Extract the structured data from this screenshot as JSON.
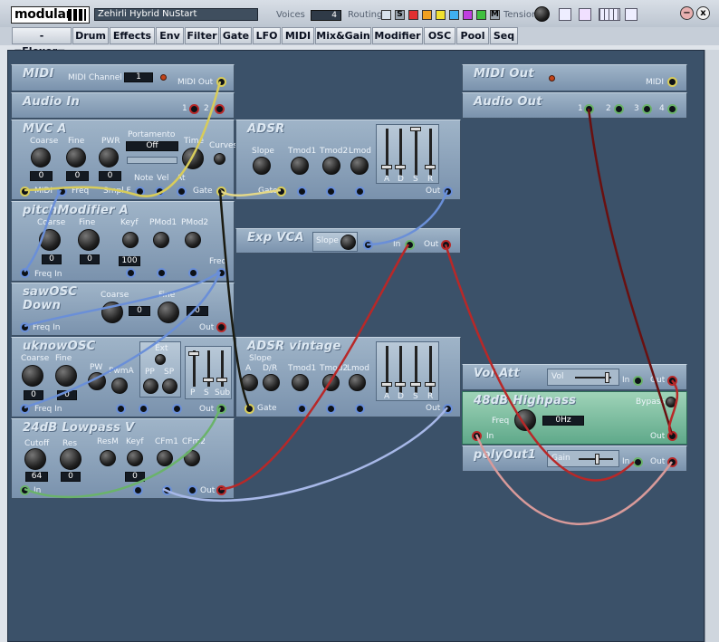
{
  "header": {
    "logo": "modular",
    "patch_name": "Zehirli  Hybrid NuStart",
    "voices_label": "Voices",
    "voices_value": "4",
    "routing_label": "Routing",
    "solo_label": "S",
    "mute_label": "M",
    "tension_label": "Tension",
    "minimize_label": "−",
    "close_label": "x"
  },
  "tabs": [
    "-=Flexor=-",
    "Drum",
    "Effects",
    "Env",
    "Filter",
    "Gate",
    "LFO",
    "MIDI",
    "Mix&Gain",
    "Modifier",
    "OSC",
    "Pool",
    "Seq"
  ],
  "colors": {
    "canvas": "#3b5169",
    "cable_yellow": "#d8cc5a",
    "cable_blue": "#6a8fd8",
    "cable_red": "#b82828",
    "cable_dark": "#6a1010",
    "cable_green": "#6ab36a",
    "cable_black": "#1a1a10",
    "cable_pink": "#d89a9a"
  },
  "modules": {
    "midi": {
      "title": "MIDI",
      "channel_label": "MIDI Channel",
      "channel_value": "1",
      "out_label": "MIDI Out"
    },
    "audio_in": {
      "title": "Audio In",
      "j1": "1",
      "j2": "2"
    },
    "mvca": {
      "title": "MVC A",
      "coarse": "Coarse",
      "fine": "Fine",
      "pwr": "PWR",
      "portamento": "Portamento",
      "porta_value": "Off",
      "time": "Time",
      "curves": "Curves",
      "coarse_val": "0",
      "fine_val": "0",
      "pwr_val": "0",
      "note": "Note",
      "vel": "Vel",
      "at": "At",
      "midi": "MIDI",
      "freq": "Freq",
      "smpl": "Smpl F",
      "gate": "Gate"
    },
    "adsr": {
      "title": "ADSR",
      "slope": "Slope",
      "tmod1": "Tmod1",
      "tmod2": "Tmod2",
      "lmod": "Lmod",
      "gate": "Gate",
      "out": "Out",
      "a": "A",
      "d": "D",
      "s": "S",
      "r": "R"
    },
    "pitchmod": {
      "title": "pitchModifier A",
      "coarse": "Coarse",
      "fine": "Fine",
      "keyf": "Keyf",
      "pmod1": "PMod1",
      "pmod2": "PMod2",
      "coarse_val": "0",
      "fine_val": "0",
      "keyf_val": "100",
      "freq_in": "Freq In",
      "freq": "Freq"
    },
    "expvca": {
      "title": "Exp VCA",
      "slope": "Slope",
      "in": "In",
      "out": "Out"
    },
    "sawosc": {
      "title": "sawOSC",
      "title2": "Down",
      "coarse": "Coarse",
      "fine": "Fine",
      "coarse_val": "0",
      "fine_val": "0",
      "freq_in": "Freq In",
      "out": "Out"
    },
    "uknowosc": {
      "title": "uknowOSC",
      "coarse": "Coarse",
      "fine": "Fine",
      "pw": "PW",
      "pwma": "PwmA",
      "ext": "Ext",
      "pp": "PP",
      "sp": "SP",
      "coarse_val": "0",
      "fine_val": "0",
      "freq_in": "Freq In",
      "out": "Out",
      "p": "P",
      "s": "S",
      "sub": "Sub"
    },
    "adsrv": {
      "title": "ADSR vintage",
      "slope": "Slope",
      "a": "A",
      "dr": "D/R",
      "tmod1": "Tmod1",
      "tmod2": "Tmod2",
      "lmod": "Lmod",
      "gate": "Gate",
      "out": "Out",
      "sa": "A",
      "sd": "D",
      "ss": "S",
      "sr": "R"
    },
    "lowpass": {
      "title": "24dB Lowpass V",
      "cutoff": "Cutoff",
      "res": "Res",
      "resm": "ResM",
      "keyf": "Keyf",
      "cfm1": "CFm1",
      "cfm2": "CFm2",
      "cutoff_val": "64",
      "res_val": "0",
      "keyf_val": "0",
      "in": "In",
      "out": "Out"
    },
    "midiout": {
      "title": "MIDI Out",
      "midi": "MIDI"
    },
    "audioout": {
      "title": "Audio Out",
      "j1": "1",
      "j2": "2",
      "j3": "3",
      "j4": "4"
    },
    "volatt": {
      "title": "Vol Att",
      "vol": "Vol",
      "in": "In",
      "out": "Out"
    },
    "highpass": {
      "title": "48dB Highpass",
      "bypass": "Bypass",
      "freq": "Freq",
      "freq_val": "0Hz",
      "in": "In",
      "out": "Out"
    },
    "polyout": {
      "title": "polyOut1",
      "gain": "Gain",
      "in": "In",
      "out": "Out"
    }
  }
}
